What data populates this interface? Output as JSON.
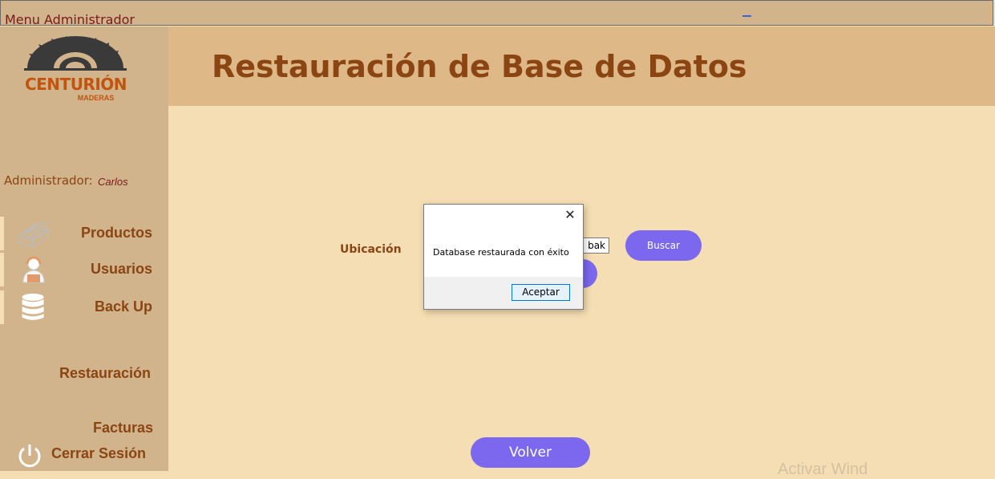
{
  "window": {
    "title": "Menu Administrador"
  },
  "brand": {
    "name": "CENTURIÓN",
    "sub": "MADERAS"
  },
  "admin": {
    "label": "Administrador:",
    "name": "Carlos"
  },
  "nav": {
    "items": [
      {
        "label": "Productos",
        "icon": "lumber-icon"
      },
      {
        "label": "Usuarios",
        "icon": "user-icon"
      },
      {
        "label": "Back Up",
        "icon": "database-icon"
      }
    ],
    "restauracion": "Restauración",
    "facturas": "Facturas",
    "logout": "Cerrar Sesión"
  },
  "header": {
    "title": "Restauración de Base de Datos"
  },
  "form": {
    "location_label": "Ubicación",
    "path_value": "bak",
    "search_label": "Buscar"
  },
  "footer": {
    "back_label": "Volver",
    "watermark": "Activar Wind"
  },
  "dialog": {
    "message": "Database restaurada con éxito",
    "ok_label": "Aceptar"
  },
  "colors": {
    "sidebar": "#D2B48C",
    "header": "#DEB887",
    "content": "#F5DEB3",
    "text": "#8B4513",
    "accent": "#7B68EE"
  }
}
